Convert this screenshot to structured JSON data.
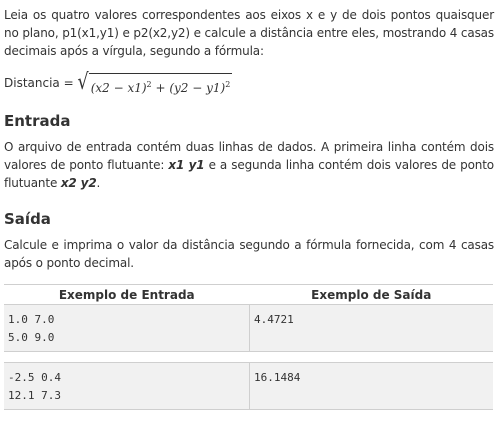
{
  "intro": {
    "text": "Leia os quatro valores correspondentes aos eixos x e y de dois pontos quaisquer no plano, p1(x1,y1) e p2(x2,y2) e calcule a distância entre eles, mostrando 4 casas decimais após a vírgula, segundo a fórmula:"
  },
  "formula": {
    "label": "Distancia =",
    "radicand": "(x2 − x1)",
    "exp1": "2",
    "plus": " + (y2 − y1)",
    "exp2": "2"
  },
  "entrada": {
    "heading": "Entrada",
    "text_before": "O arquivo de entrada contém duas linhas de dados. A primeira linha contém dois valores de ponto flutuante: ",
    "em1": "x1 y1",
    "text_middle": " e a segunda linha contém dois valores de ponto flutuante ",
    "em2": "x2 y2",
    "text_after": "."
  },
  "saida": {
    "heading": "Saída",
    "text": "Calcule e imprima o valor da distância segundo a fórmula fornecida, com 4 casas após o ponto decimal."
  },
  "examples": {
    "header_input": "Exemplo de Entrada",
    "header_output": "Exemplo de Saída",
    "cases": [
      {
        "input_line1": "1.0 7.0",
        "input_line2": "5.0 9.0",
        "output": "4.4721"
      },
      {
        "input_line1": "-2.5 0.4",
        "input_line2": "12.1 7.3",
        "output": "16.1484"
      }
    ]
  }
}
